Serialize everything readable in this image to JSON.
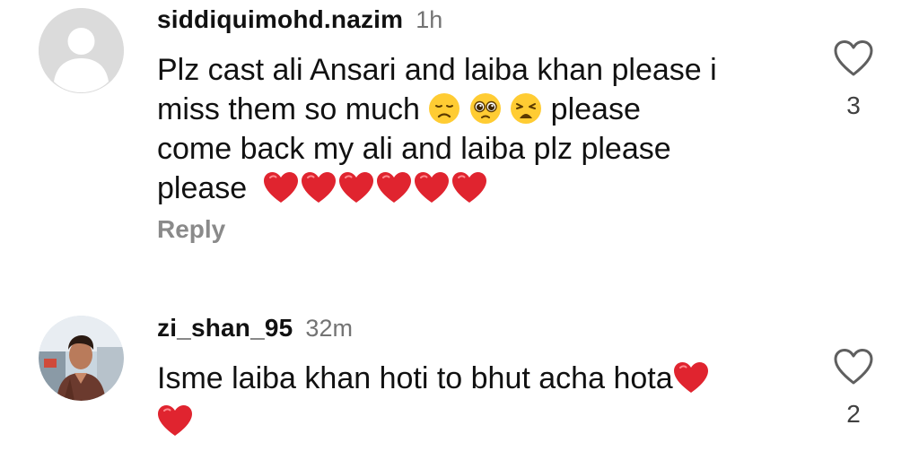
{
  "comments": [
    {
      "username": "siddiquimohd.nazim",
      "time": "1h",
      "text_line1": "Plz cast ali Ansari and laiba khan please i",
      "text_line2_a": "miss them so much",
      "text_line2_b": "please",
      "text_line3": "come back my ali and laiba plz please",
      "text_line4": "please",
      "emoji_line2": [
        "disappointed-face",
        "pleading-face",
        "weary-face"
      ],
      "hearts_line4": 6,
      "reply_label": "Reply",
      "like_count": "3"
    },
    {
      "username": "zi_shan_95",
      "time": "32m",
      "text_line1": "Isme laiba khan hoti to bhut acha hota",
      "hearts_line1": 1,
      "hearts_line2": 1,
      "like_count": "2"
    }
  ],
  "colors": {
    "heart": "#e0242f",
    "emoji_yellow": "#ffcc33",
    "muted": "#737373",
    "reply": "#8a8a8a"
  }
}
